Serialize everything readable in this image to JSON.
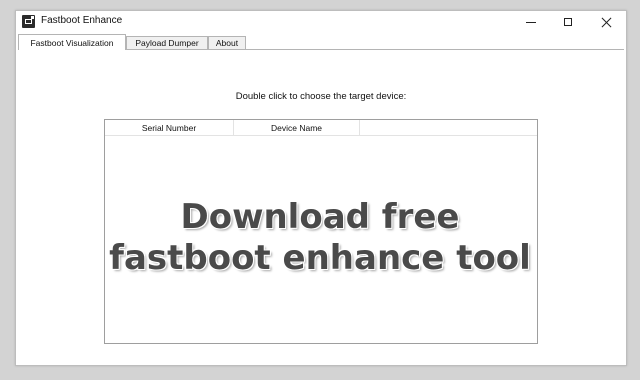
{
  "window": {
    "title": "Fastboot Enhance"
  },
  "tabs": [
    {
      "label": "Fastboot Visualization",
      "active": true
    },
    {
      "label": "Payload Dumper",
      "active": false
    },
    {
      "label": "About",
      "active": false
    }
  ],
  "main": {
    "instruction": "Double click to choose the target device:",
    "device_list": {
      "columns": [
        "Serial Number",
        "Device Name"
      ],
      "rows": []
    }
  },
  "overlay": {
    "line1": "Download free",
    "line2": "fastboot enhance tool"
  },
  "colors": {
    "background": "#d3d3d3",
    "window": "#ffffff",
    "overlay_text": "#4a4a4a"
  },
  "icons": [
    "app-icon",
    "minimize-icon",
    "maximize-icon",
    "close-icon"
  ]
}
